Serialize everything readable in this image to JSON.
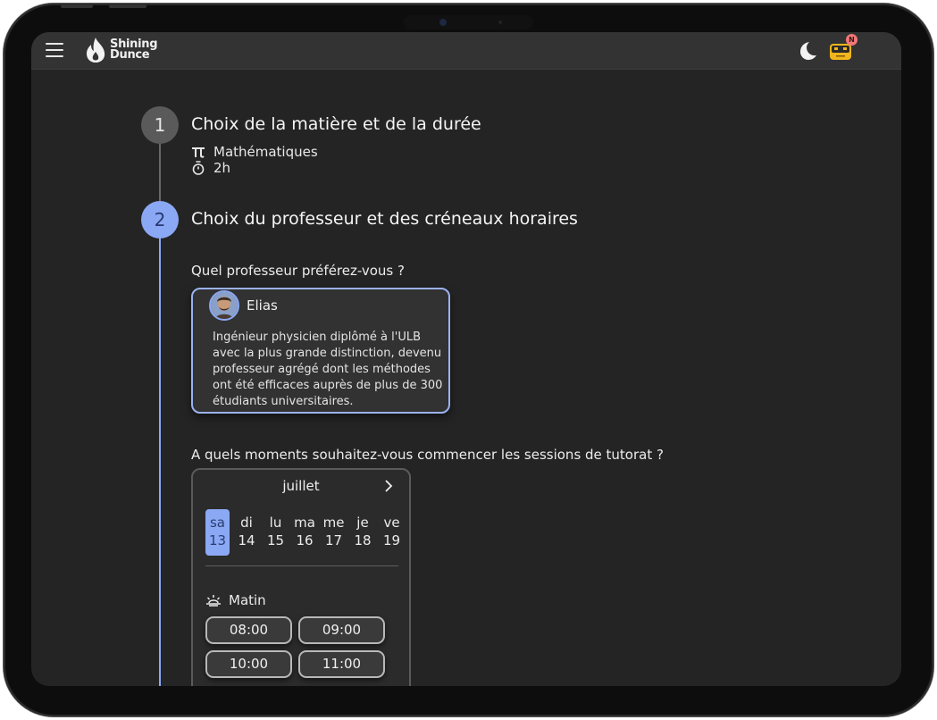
{
  "app": {
    "logo_line1": "Shining",
    "logo_line2": "Dunce",
    "notification_badge": "N"
  },
  "steps": [
    {
      "number": "1",
      "title": "Choix de la matière et de la durée",
      "subject": "Mathématiques",
      "subject_icon": "pi-icon",
      "duration": "2h",
      "duration_icon": "stopwatch-icon"
    },
    {
      "number": "2",
      "title": "Choix du professeur et des créneaux horaires"
    }
  ],
  "professor_question": "Quel professeur préférez-vous ?",
  "professor": {
    "name": "Elias",
    "description": "Ingénieur physicien diplômé à l'ULB avec la plus grande distinction, devenu professeur agrégé dont les méthodes ont été efficaces auprès de plus de 300 étudiants universitaires."
  },
  "schedule_question": "A quels moments souhaitez-vous commencer les sessions de tutorat ?",
  "calendar": {
    "month": "juillet",
    "days": [
      {
        "weekday": "sa",
        "date": "13",
        "selected": true
      },
      {
        "weekday": "di",
        "date": "14",
        "selected": false
      },
      {
        "weekday": "lu",
        "date": "15",
        "selected": false
      },
      {
        "weekday": "ma",
        "date": "16",
        "selected": false
      },
      {
        "weekday": "me",
        "date": "17",
        "selected": false
      },
      {
        "weekday": "je",
        "date": "18",
        "selected": false
      },
      {
        "weekday": "ve",
        "date": "19",
        "selected": false
      }
    ],
    "period_label": "Matin",
    "slots": [
      "08:00",
      "09:00",
      "10:00",
      "11:00"
    ]
  },
  "colors": {
    "accent": "#8ba8f5",
    "background": "#242424",
    "topbar": "#333333",
    "badge": "#f47878"
  }
}
